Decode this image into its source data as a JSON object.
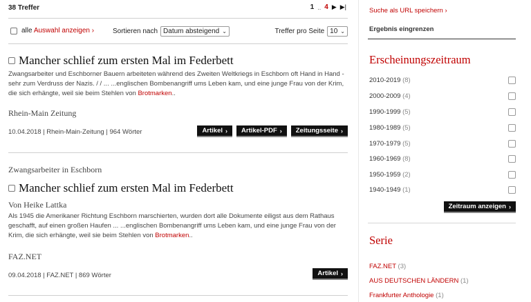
{
  "results": {
    "count_label": "38 Treffer",
    "pager": {
      "first": "1",
      "dots": "..",
      "current": "4",
      "next": "▶",
      "last": "▶|"
    }
  },
  "controls": {
    "show_label": "alle",
    "show_link": "Auswahl anzeigen",
    "sort_label": "Sortieren nach",
    "sort_value": "Datum absteigend",
    "per_page_label": "Treffer pro Seite",
    "per_page_value": "10"
  },
  "articles": [
    {
      "title": "Mancher schlief zum ersten Mal im Federbett",
      "snippet_pre": "Zwangsarbeiter und Eschborner Bauern arbeiteten während des Zweiten Weltkriegs in Eschborn oft Hand in Hand - sehr zum Verdruss der Nazis. / / ... ...englischen Bombenangriff ums Leben kam, und eine junge Frau von der Krim, die sich erhängte, weil sie beim Stehlen von",
      "snippet_highlight": "Brotmarken",
      "snippet_post": "..",
      "source": "Rhein-Main Zeitung",
      "meta": "10.04.2018  |  Rhein-Main-Zeitung  |  964 Wörter",
      "buttons": [
        "Artikel",
        "Artikel-PDF",
        "Zeitungsseite"
      ]
    },
    {
      "kicker": "Zwangsarbeiter in Eschborn",
      "title": "Mancher schlief zum ersten Mal im Federbett",
      "author": "Von Heike Lattka",
      "snippet_pre": "Als 1945 die Amerikaner Richtung Eschborn marschierten, wurden dort alle Dokumente eiligst aus dem Rathaus geschafft, auf einen großen Haufen ... ...englischen Bombenangriff ums Leben kam, und eine junge Frau von der Krim, die sich erhängte, weil sie beim Stehlen von",
      "snippet_highlight": "Brotmarken",
      "snippet_post": "..",
      "source": "FAZ.NET",
      "meta": "09.04.2018  |  FAZ.NET  |  869 Wörter",
      "buttons": [
        "Artikel"
      ]
    }
  ],
  "sidebar": {
    "save_link": "Suche als URL speichern",
    "narrow_label": "Ergebnis eingrenzen",
    "period_heading": "Erscheinungszeitraum",
    "periods": [
      {
        "label": "2010-2019",
        "count": "(8)"
      },
      {
        "label": "2000-2009",
        "count": "(4)"
      },
      {
        "label": "1990-1999",
        "count": "(5)"
      },
      {
        "label": "1980-1989",
        "count": "(5)"
      },
      {
        "label": "1970-1979",
        "count": "(5)"
      },
      {
        "label": "1960-1969",
        "count": "(8)"
      },
      {
        "label": "1950-1959",
        "count": "(2)"
      },
      {
        "label": "1940-1949",
        "count": "(1)"
      }
    ],
    "period_button": "Zeitraum anzeigen",
    "serie_heading": "Serie",
    "series": [
      {
        "label": "FAZ.NET",
        "count": "(3)"
      },
      {
        "label": "AUS DEUTSCHEN LÄNDERN",
        "count": "(1)"
      },
      {
        "label": "Frankfurter Anthologie",
        "count": "(1)"
      }
    ]
  },
  "colors": {
    "accent": "#c00000",
    "button_bg": "#111111"
  }
}
